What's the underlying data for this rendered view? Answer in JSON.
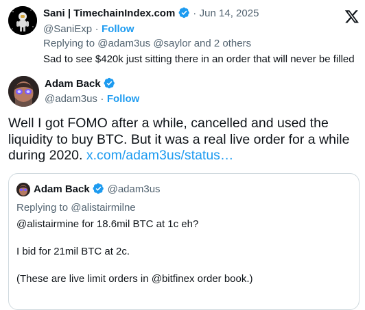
{
  "reply_tweet": {
    "author_name": "Sani | TimechainIndex.com",
    "date": "Jun 14, 2025",
    "handle": "@SaniExp",
    "separator": "·",
    "follow_label": "Follow",
    "replying_to": "Replying to @adam3us @saylor and 2 others",
    "text": "Sad to see $420k just sitting there in an order that will never be filled"
  },
  "main_tweet": {
    "author_name": "Adam Back",
    "handle": "@adam3us",
    "separator": "·",
    "follow_label": "Follow",
    "text_line1": "Well I got FOMO after a while, cancelled and used the",
    "text_line2": "liquidity to buy BTC. But it was a real live order for a while",
    "text_line3_prefix": "during 2020.",
    "link_text": "x.com/adam3us/status…"
  },
  "quoted_tweet": {
    "author_name": "Adam Back",
    "handle": "@adam3us",
    "replying_to": "Replying to @alistairmilne",
    "line1": "@alistairmine for 18.6mil BTC at 1c eh?",
    "line2": "I bid for 21mil BTC at 2c.",
    "line3": "(These are live limit orders in @bitfinex order book.)"
  },
  "brand": {
    "logo": "X",
    "accent_color": "#1d9bf0",
    "text_color": "#0f1419",
    "muted_color": "#536471"
  },
  "icons": {
    "verified": "verified-badge-icon",
    "logo": "x-logo-icon"
  }
}
